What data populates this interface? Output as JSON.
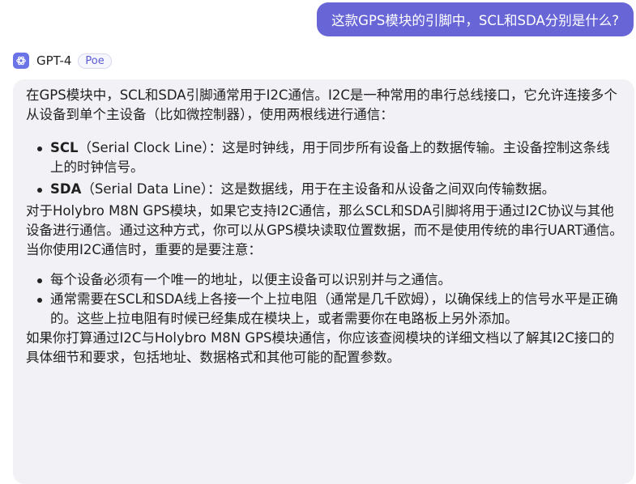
{
  "user_message": "这款GPS模块的引脚中，SCL和SDA分别是什么?",
  "bot": {
    "name": "GPT-4",
    "badge": "Poe"
  },
  "response": {
    "intro": "在GPS模块中，SCL和SDA引脚通常用于I2C通信。I2C是一种常用的串行总线接口，它允许连接多个从设备到单个主设备（比如微控制器），使用两根线进行通信：",
    "definitions": [
      {
        "term": "SCL",
        "desc": "（Serial Clock Line）：这是时钟线，用于同步所有设备上的数据传输。主设备控制这条线上的时钟信号。"
      },
      {
        "term": "SDA",
        "desc": "（Serial Data Line）：这是数据线，用于在主设备和从设备之间双向传输数据。"
      }
    ],
    "para2": "对于Holybro M8N GPS模块，如果它支持I2C通信，那么SCL和SDA引脚将用于通过I2C协议与其他设备进行通信。通过这种方式，你可以从GPS模块读取位置数据，而不是使用传统的串行UART通信。",
    "para3": "当你使用I2C通信时，重要的是要注意：",
    "notes": [
      "每个设备必须有一个唯一的地址，以便主设备可以识别并与之通信。",
      "通常需要在SCL和SDA线上各接一个上拉电阻（通常是几千欧姆），以确保线上的信号水平是正确的。这些上拉电阻有时候已经集成在模块上，或者需要你在电路板上另外添加。"
    ],
    "para4": "如果你打算通过I2C与Holybro M8N GPS模块通信，你应该查阅模块的详细文档以了解其I2C接口的具体细节和要求，包括地址、数据格式和其他可能的配置参数。"
  }
}
